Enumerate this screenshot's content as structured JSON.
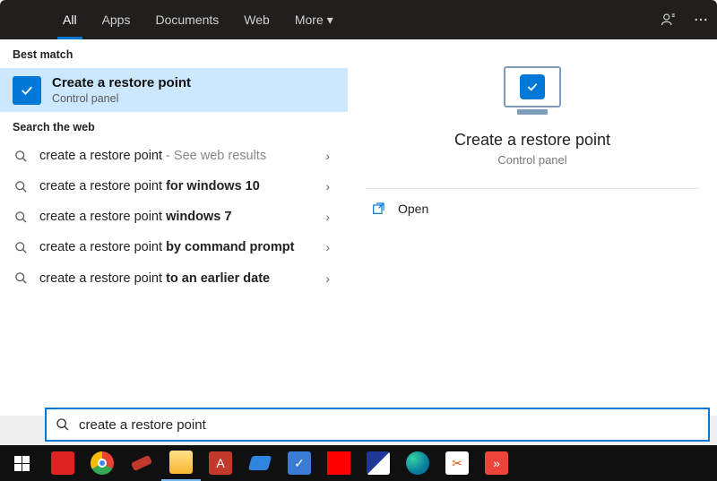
{
  "header": {
    "tabs": {
      "all": "All",
      "apps": "Apps",
      "documents": "Documents",
      "web": "Web",
      "more": "More"
    }
  },
  "left": {
    "best_match_label": "Best match",
    "best_match": {
      "title": "Create a restore point",
      "subtitle": "Control panel"
    },
    "search_web_label": "Search the web",
    "web": [
      {
        "prefix": "create a restore point",
        "suffix": "",
        "tail": " - See web results"
      },
      {
        "prefix": "create a restore point ",
        "suffix": "for windows 10",
        "tail": ""
      },
      {
        "prefix": "create a restore point ",
        "suffix": "windows 7",
        "tail": ""
      },
      {
        "prefix": "create a restore point ",
        "suffix": "by command prompt",
        "tail": ""
      },
      {
        "prefix": "create a restore point ",
        "suffix": "to an earlier date",
        "tail": ""
      }
    ]
  },
  "right": {
    "title": "Create a restore point",
    "subtitle": "Control panel",
    "open": "Open"
  },
  "search": {
    "value": "create a restore point"
  },
  "colors": {
    "accent": "#0078d7",
    "highlight": "#cce8ff"
  }
}
